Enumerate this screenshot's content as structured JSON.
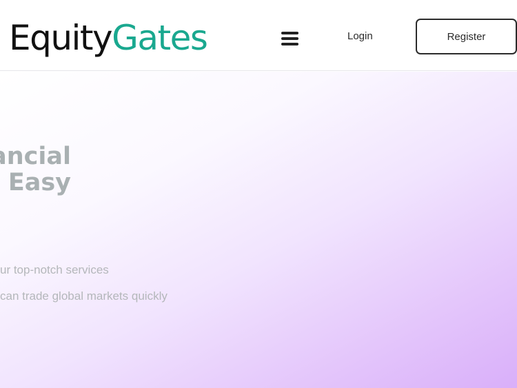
{
  "header": {
    "logo_part1": "Equity",
    "logo_part2": "Gates",
    "menu_icon": "hamburger-menu-icon",
    "login_label": "Login",
    "register_label": "Register"
  },
  "hero": {
    "headline_line1": "ancial",
    "headline_line2": "Easy",
    "subtext_line1": "ur top-notch services",
    "subtext_line2": "can trade global markets quickly"
  },
  "colors": {
    "brand_dark": "#111111",
    "brand_accent": "#1aa88f",
    "gradient_end": "#d9affa"
  }
}
